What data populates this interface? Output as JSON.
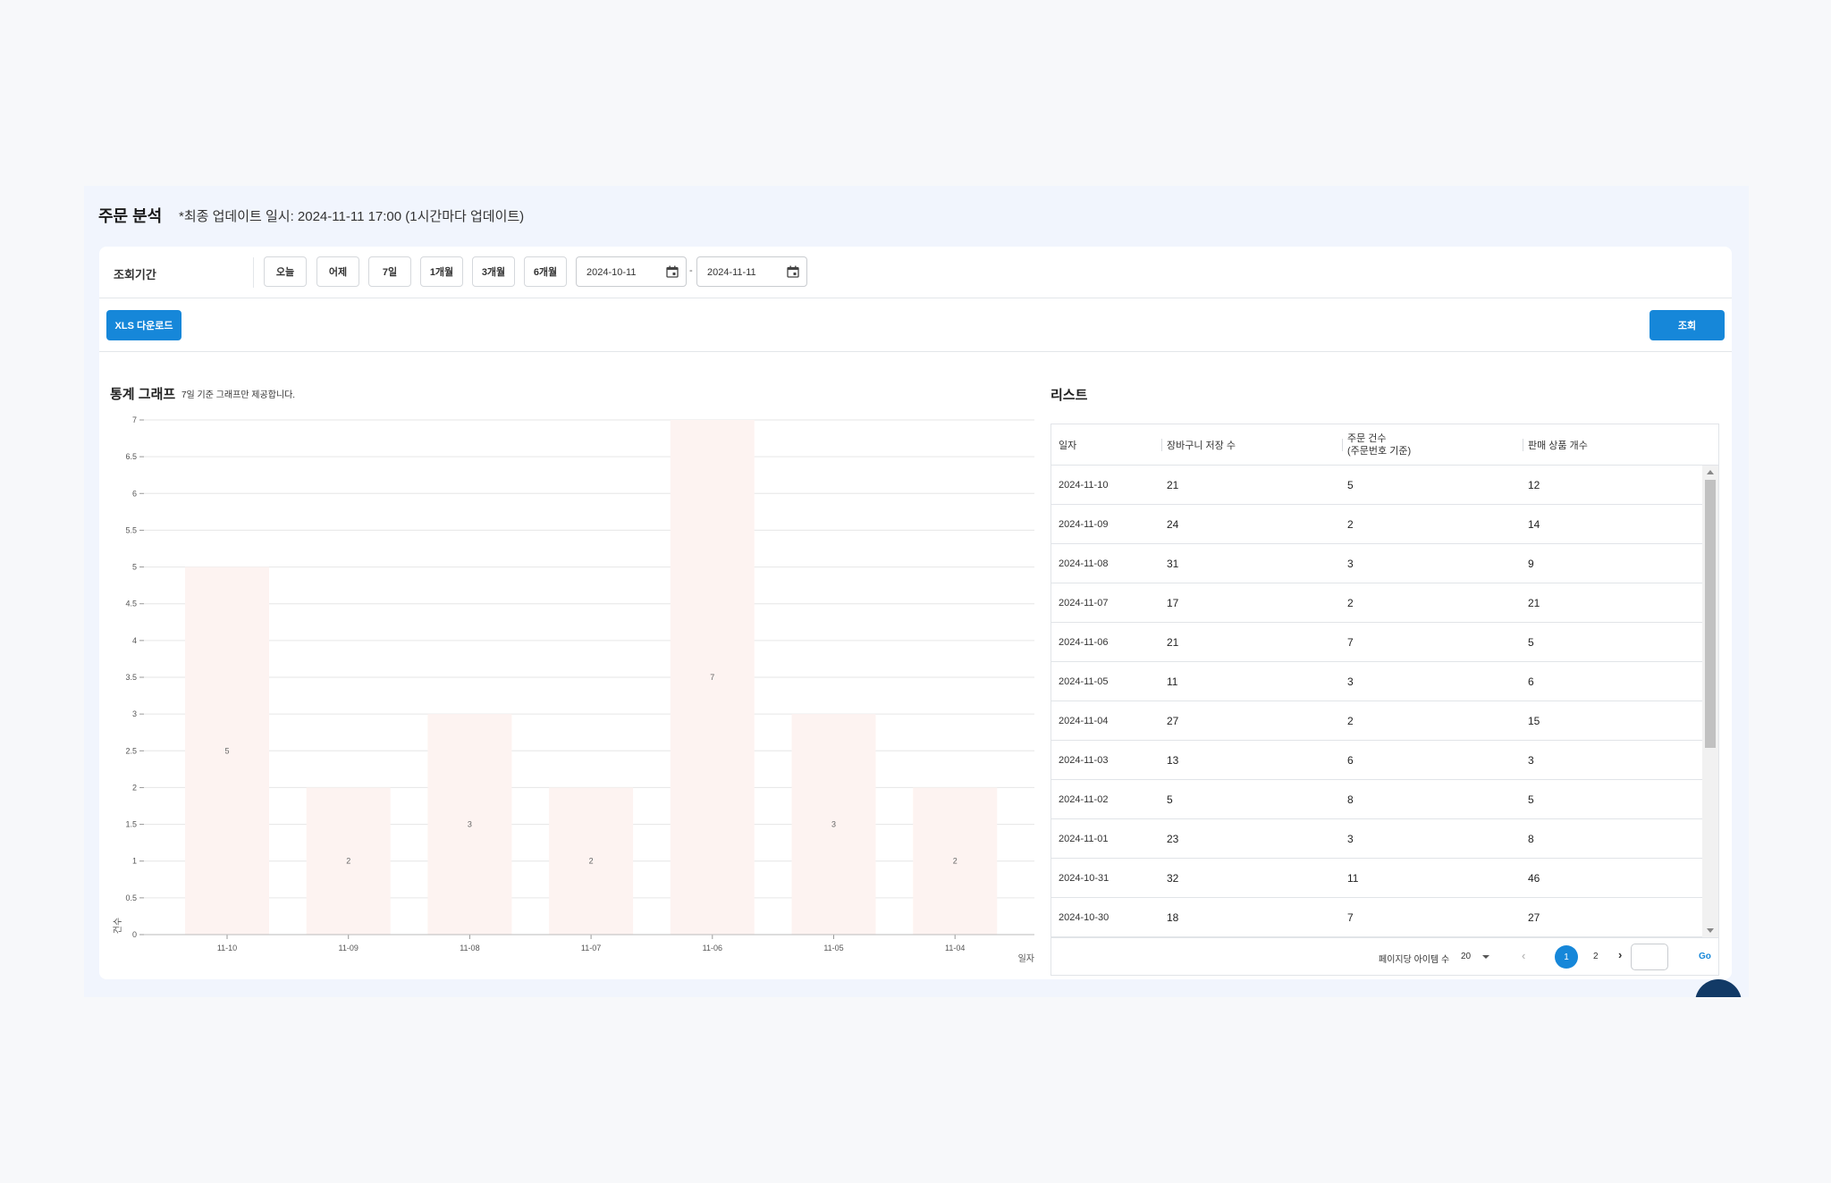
{
  "header": {
    "title": "주문 분석",
    "update_note": "*최종 업데이트 일시: 2024-11-11 17:00 (1시간마다 업데이트)"
  },
  "filter": {
    "label": "조회기간",
    "period_buttons": [
      "오늘",
      "어제",
      "7일",
      "1개월",
      "3개월",
      "6개월"
    ],
    "start_date": "2024-10-11",
    "separator": "-",
    "end_date": "2024-11-11"
  },
  "actions": {
    "xls_label": "XLS 다운로드",
    "search_label": "조회"
  },
  "graph": {
    "title": "통계 그래프",
    "note": "7일 기준 그래프만 제공합니다."
  },
  "chart_data": {
    "type": "bar",
    "categories": [
      "11-10",
      "11-09",
      "11-08",
      "11-07",
      "11-06",
      "11-05",
      "11-04"
    ],
    "values": [
      5,
      2,
      3,
      2,
      7,
      3,
      2
    ],
    "xlabel": "일자",
    "ylabel": "건수",
    "ylim": [
      0,
      7
    ],
    "yticks": [
      "0",
      "0.5",
      "1",
      "1.5",
      "2",
      "2.5",
      "3",
      "3.5",
      "4",
      "4.5",
      "5",
      "5.5",
      "6",
      "6.5",
      "7"
    ],
    "bar_color": "#fdf3f1",
    "grid": true,
    "data_labels": true
  },
  "list": {
    "title": "리스트",
    "columns": [
      "일자",
      "장바구니 저장 수",
      "주문 건수",
      "(주문번호 기준)",
      "판매 상품 개수"
    ],
    "rows": [
      [
        "2024-11-10",
        "21",
        "5",
        "12"
      ],
      [
        "2024-11-09",
        "24",
        "2",
        "14"
      ],
      [
        "2024-11-08",
        "31",
        "3",
        "9"
      ],
      [
        "2024-11-07",
        "17",
        "2",
        "21"
      ],
      [
        "2024-11-06",
        "21",
        "7",
        "5"
      ],
      [
        "2024-11-05",
        "11",
        "3",
        "6"
      ],
      [
        "2024-11-04",
        "27",
        "2",
        "15"
      ],
      [
        "2024-11-03",
        "13",
        "6",
        "3"
      ],
      [
        "2024-11-02",
        "5",
        "8",
        "5"
      ],
      [
        "2024-11-01",
        "23",
        "3",
        "8"
      ],
      [
        "2024-10-31",
        "32",
        "11",
        "46"
      ],
      [
        "2024-10-30",
        "18",
        "7",
        "27"
      ]
    ]
  },
  "pagination": {
    "items_per_page_label": "페이지당 아이템 수",
    "items_per_page": "20",
    "prev": "‹",
    "pages": [
      "1",
      "2"
    ],
    "next": "›",
    "go_label": "Go"
  },
  "colors": {
    "accent": "#1687d9",
    "background": "#f1f5fd"
  }
}
